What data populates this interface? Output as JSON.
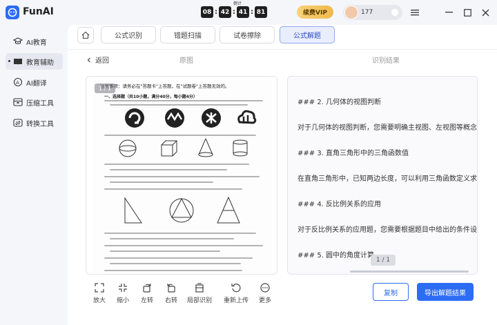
{
  "app": {
    "title": "FunAI",
    "timer_label": "倒计",
    "timer": [
      "08",
      "42",
      "41",
      "81"
    ],
    "vip_label": "续费VIP",
    "user_name": "177"
  },
  "sidebar": {
    "items": [
      {
        "label": "AI教育",
        "icon": "graduation-cap-icon"
      },
      {
        "label": "教育辅助",
        "icon": "book-icon",
        "active": true
      },
      {
        "label": "AI翻译",
        "icon": "translate-icon"
      },
      {
        "label": "压缩工具",
        "icon": "archive-icon"
      },
      {
        "label": "转换工具",
        "icon": "convert-icon"
      }
    ]
  },
  "tabs": [
    {
      "label": "公式识别"
    },
    {
      "label": "错题扫描"
    },
    {
      "label": "试卷擦除"
    },
    {
      "label": "公式解题",
      "active": true
    }
  ],
  "header": {
    "back_label": "返回",
    "original_label": "原图",
    "result_label": "识别结果"
  },
  "left_panel": {
    "page_badge": "1 / 1",
    "scan_header": "注意事项：请务必在\"答题卡\"上答题，在\"试题卷\"上答题无效的。",
    "scan_section": "一、选择题（共10小题，满分40分，每小题4分）"
  },
  "right_panel": {
    "lines": [
      "### 2. 几何体的视图判断",
      "对于几何体的视图判断，您需要明确主视图、左视图等概念，并",
      "### 3. 直角三角形中的三角函数值",
      "在直角三角形中，已知两边长度，可以利用三角函数定义求出某",
      "### 4. 反比例关系的应用",
      "对于反比例关系的应用题，您需要根据题目中给出的条件设立反",
      "### 5. 圆中的角度计算"
    ],
    "page_badge": "1 / 1"
  },
  "toolbar": [
    {
      "label": "放大",
      "icon": "zoom-in-icon"
    },
    {
      "label": "缩小",
      "icon": "zoom-out-icon"
    },
    {
      "label": "左转",
      "icon": "rotate-left-icon"
    },
    {
      "label": "右转",
      "icon": "rotate-right-icon"
    },
    {
      "label": "局部识别",
      "icon": "partial-scan-icon"
    },
    {
      "label": "重新上传",
      "icon": "reupload-icon"
    },
    {
      "label": "更多",
      "icon": "more-icon"
    }
  ],
  "actions": {
    "copy_label": "复制",
    "export_label": "导出解题结果"
  },
  "colors": {
    "primary": "#2d6cf5",
    "vip": "#f0b84a"
  }
}
